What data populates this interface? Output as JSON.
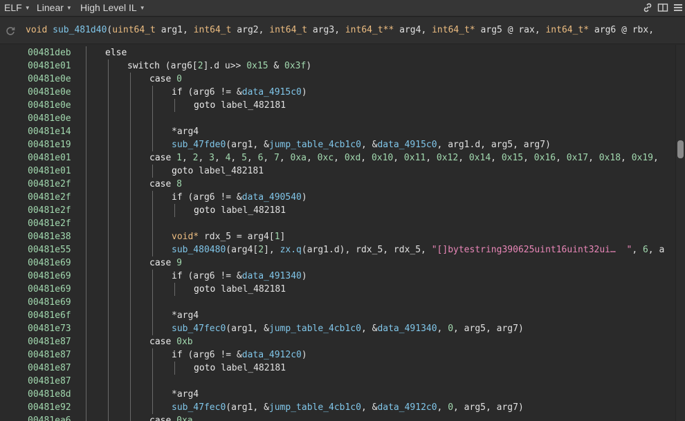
{
  "toolbar": {
    "view_type": "ELF",
    "layout": "Linear",
    "il_level": "High Level IL"
  },
  "signature": [
    {
      "t": "void",
      "c": "type"
    },
    {
      "t": " ",
      "c": "def"
    },
    {
      "t": "sub_481d40",
      "c": "func"
    },
    {
      "t": "(",
      "c": "def"
    },
    {
      "t": "uint64_t",
      "c": "type"
    },
    {
      "t": " arg1, ",
      "c": "def"
    },
    {
      "t": "int64_t",
      "c": "type"
    },
    {
      "t": " arg2, ",
      "c": "def"
    },
    {
      "t": "int64_t",
      "c": "type"
    },
    {
      "t": " arg3, ",
      "c": "def"
    },
    {
      "t": "int64_t**",
      "c": "type"
    },
    {
      "t": " arg4, ",
      "c": "def"
    },
    {
      "t": "int64_t*",
      "c": "type"
    },
    {
      "t": " arg5 @ rax, ",
      "c": "def"
    },
    {
      "t": "int64_t*",
      "c": "type"
    },
    {
      "t": " arg6 @ rbx, ",
      "c": "def"
    }
  ],
  "lines": [
    {
      "addr": "00481deb",
      "indent": 0,
      "tokens": [
        {
          "t": "else",
          "c": "kw"
        }
      ]
    },
    {
      "addr": "00481e01",
      "indent": 1,
      "tokens": [
        {
          "t": "switch",
          "c": "kw"
        },
        {
          "t": " (arg6[",
          "c": "def"
        },
        {
          "t": "2",
          "c": "num"
        },
        {
          "t": "].d u>> ",
          "c": "def"
        },
        {
          "t": "0x15",
          "c": "num"
        },
        {
          "t": " & ",
          "c": "def"
        },
        {
          "t": "0x3f",
          "c": "num"
        },
        {
          "t": ")",
          "c": "def"
        }
      ]
    },
    {
      "addr": "00481e0e",
      "indent": 2,
      "tokens": [
        {
          "t": "case",
          "c": "kw"
        },
        {
          "t": " ",
          "c": "def"
        },
        {
          "t": "0",
          "c": "num"
        }
      ]
    },
    {
      "addr": "00481e0e",
      "indent": 3,
      "tokens": [
        {
          "t": "if",
          "c": "kw"
        },
        {
          "t": " (arg6 != &",
          "c": "def"
        },
        {
          "t": "data_4915c0",
          "c": "sym"
        },
        {
          "t": ")",
          "c": "def"
        }
      ]
    },
    {
      "addr": "00481e0e",
      "indent": 4,
      "tokens": [
        {
          "t": "goto",
          "c": "kw"
        },
        {
          "t": " label_482181",
          "c": "label"
        }
      ]
    },
    {
      "addr": "00481e0e",
      "indent": 3,
      "tokens": []
    },
    {
      "addr": "00481e14",
      "indent": 3,
      "tokens": [
        {
          "t": "*arg4",
          "c": "def"
        }
      ]
    },
    {
      "addr": "00481e19",
      "indent": 3,
      "tokens": [
        {
          "t": "sub_47fde0",
          "c": "func"
        },
        {
          "t": "(arg1, &",
          "c": "def"
        },
        {
          "t": "jump_table_4cb1c0",
          "c": "sym"
        },
        {
          "t": ", &",
          "c": "def"
        },
        {
          "t": "data_4915c0",
          "c": "sym"
        },
        {
          "t": ", arg1.d, arg5, arg7)",
          "c": "def"
        }
      ]
    },
    {
      "addr": "00481e01",
      "indent": 2,
      "tokens": [
        {
          "t": "case",
          "c": "kw"
        },
        {
          "t": " ",
          "c": "def"
        },
        {
          "t": "1",
          "c": "num"
        },
        {
          "t": ", ",
          "c": "def"
        },
        {
          "t": "2",
          "c": "num"
        },
        {
          "t": ", ",
          "c": "def"
        },
        {
          "t": "3",
          "c": "num"
        },
        {
          "t": ", ",
          "c": "def"
        },
        {
          "t": "4",
          "c": "num"
        },
        {
          "t": ", ",
          "c": "def"
        },
        {
          "t": "5",
          "c": "num"
        },
        {
          "t": ", ",
          "c": "def"
        },
        {
          "t": "6",
          "c": "num"
        },
        {
          "t": ", ",
          "c": "def"
        },
        {
          "t": "7",
          "c": "num"
        },
        {
          "t": ", ",
          "c": "def"
        },
        {
          "t": "0xa",
          "c": "num"
        },
        {
          "t": ", ",
          "c": "def"
        },
        {
          "t": "0xc",
          "c": "num"
        },
        {
          "t": ", ",
          "c": "def"
        },
        {
          "t": "0xd",
          "c": "num"
        },
        {
          "t": ", ",
          "c": "def"
        },
        {
          "t": "0x10",
          "c": "num"
        },
        {
          "t": ", ",
          "c": "def"
        },
        {
          "t": "0x11",
          "c": "num"
        },
        {
          "t": ", ",
          "c": "def"
        },
        {
          "t": "0x12",
          "c": "num"
        },
        {
          "t": ", ",
          "c": "def"
        },
        {
          "t": "0x14",
          "c": "num"
        },
        {
          "t": ", ",
          "c": "def"
        },
        {
          "t": "0x15",
          "c": "num"
        },
        {
          "t": ", ",
          "c": "def"
        },
        {
          "t": "0x16",
          "c": "num"
        },
        {
          "t": ", ",
          "c": "def"
        },
        {
          "t": "0x17",
          "c": "num"
        },
        {
          "t": ", ",
          "c": "def"
        },
        {
          "t": "0x18",
          "c": "num"
        },
        {
          "t": ", ",
          "c": "def"
        },
        {
          "t": "0x19",
          "c": "num"
        },
        {
          "t": ",",
          "c": "def"
        }
      ]
    },
    {
      "addr": "00481e01",
      "indent": 3,
      "tokens": [
        {
          "t": "goto",
          "c": "kw"
        },
        {
          "t": " label_482181",
          "c": "label"
        }
      ]
    },
    {
      "addr": "00481e2f",
      "indent": 2,
      "tokens": [
        {
          "t": "case",
          "c": "kw"
        },
        {
          "t": " ",
          "c": "def"
        },
        {
          "t": "8",
          "c": "num"
        }
      ]
    },
    {
      "addr": "00481e2f",
      "indent": 3,
      "tokens": [
        {
          "t": "if",
          "c": "kw"
        },
        {
          "t": " (arg6 != &",
          "c": "def"
        },
        {
          "t": "data_490540",
          "c": "sym"
        },
        {
          "t": ")",
          "c": "def"
        }
      ]
    },
    {
      "addr": "00481e2f",
      "indent": 4,
      "tokens": [
        {
          "t": "goto",
          "c": "kw"
        },
        {
          "t": " label_482181",
          "c": "label"
        }
      ]
    },
    {
      "addr": "00481e2f",
      "indent": 3,
      "tokens": []
    },
    {
      "addr": "00481e38",
      "indent": 3,
      "tokens": [
        {
          "t": "void*",
          "c": "type"
        },
        {
          "t": " rdx_5 = arg4[",
          "c": "def"
        },
        {
          "t": "1",
          "c": "num"
        },
        {
          "t": "]",
          "c": "def"
        }
      ]
    },
    {
      "addr": "00481e55",
      "indent": 3,
      "tokens": [
        {
          "t": "sub_480480",
          "c": "func"
        },
        {
          "t": "(arg4[",
          "c": "def"
        },
        {
          "t": "2",
          "c": "num"
        },
        {
          "t": "], ",
          "c": "def"
        },
        {
          "t": "zx.q",
          "c": "func"
        },
        {
          "t": "(arg1.d), rdx_5, rdx_5, ",
          "c": "def"
        },
        {
          "t": "\"[]bytestring390625uint16uint32ui…  \"",
          "c": "str"
        },
        {
          "t": ", ",
          "c": "def"
        },
        {
          "t": "6",
          "c": "num"
        },
        {
          "t": ", a",
          "c": "def"
        }
      ]
    },
    {
      "addr": "00481e69",
      "indent": 2,
      "tokens": [
        {
          "t": "case",
          "c": "kw"
        },
        {
          "t": " ",
          "c": "def"
        },
        {
          "t": "9",
          "c": "num"
        }
      ]
    },
    {
      "addr": "00481e69",
      "indent": 3,
      "tokens": [
        {
          "t": "if",
          "c": "kw"
        },
        {
          "t": " (arg6 != &",
          "c": "def"
        },
        {
          "t": "data_491340",
          "c": "sym"
        },
        {
          "t": ")",
          "c": "def"
        }
      ]
    },
    {
      "addr": "00481e69",
      "indent": 4,
      "tokens": [
        {
          "t": "goto",
          "c": "kw"
        },
        {
          "t": " label_482181",
          "c": "label"
        }
      ]
    },
    {
      "addr": "00481e69",
      "indent": 3,
      "tokens": []
    },
    {
      "addr": "00481e6f",
      "indent": 3,
      "tokens": [
        {
          "t": "*arg4",
          "c": "def"
        }
      ]
    },
    {
      "addr": "00481e73",
      "indent": 3,
      "tokens": [
        {
          "t": "sub_47fec0",
          "c": "func"
        },
        {
          "t": "(arg1, &",
          "c": "def"
        },
        {
          "t": "jump_table_4cb1c0",
          "c": "sym"
        },
        {
          "t": ", &",
          "c": "def"
        },
        {
          "t": "data_491340",
          "c": "sym"
        },
        {
          "t": ", ",
          "c": "def"
        },
        {
          "t": "0",
          "c": "num"
        },
        {
          "t": ", arg5, arg7)",
          "c": "def"
        }
      ]
    },
    {
      "addr": "00481e87",
      "indent": 2,
      "tokens": [
        {
          "t": "case",
          "c": "kw"
        },
        {
          "t": " ",
          "c": "def"
        },
        {
          "t": "0xb",
          "c": "num"
        }
      ]
    },
    {
      "addr": "00481e87",
      "indent": 3,
      "tokens": [
        {
          "t": "if",
          "c": "kw"
        },
        {
          "t": " (arg6 != &",
          "c": "def"
        },
        {
          "t": "data_4912c0",
          "c": "sym"
        },
        {
          "t": ")",
          "c": "def"
        }
      ]
    },
    {
      "addr": "00481e87",
      "indent": 4,
      "tokens": [
        {
          "t": "goto",
          "c": "kw"
        },
        {
          "t": " label_482181",
          "c": "label"
        }
      ]
    },
    {
      "addr": "00481e87",
      "indent": 3,
      "tokens": []
    },
    {
      "addr": "00481e8d",
      "indent": 3,
      "tokens": [
        {
          "t": "*arg4",
          "c": "def"
        }
      ]
    },
    {
      "addr": "00481e92",
      "indent": 3,
      "tokens": [
        {
          "t": "sub_47fec0",
          "c": "func"
        },
        {
          "t": "(arg1, &",
          "c": "def"
        },
        {
          "t": "jump_table_4cb1c0",
          "c": "sym"
        },
        {
          "t": ", &",
          "c": "def"
        },
        {
          "t": "data_4912c0",
          "c": "sym"
        },
        {
          "t": ", ",
          "c": "def"
        },
        {
          "t": "0",
          "c": "num"
        },
        {
          "t": ", arg5, arg7)",
          "c": "def"
        }
      ]
    },
    {
      "addr": "00481ea6",
      "indent": 2,
      "tokens": [
        {
          "t": "case",
          "c": "kw"
        },
        {
          "t": " ",
          "c": "def"
        },
        {
          "t": "0xa",
          "c": "num"
        }
      ]
    }
  ]
}
